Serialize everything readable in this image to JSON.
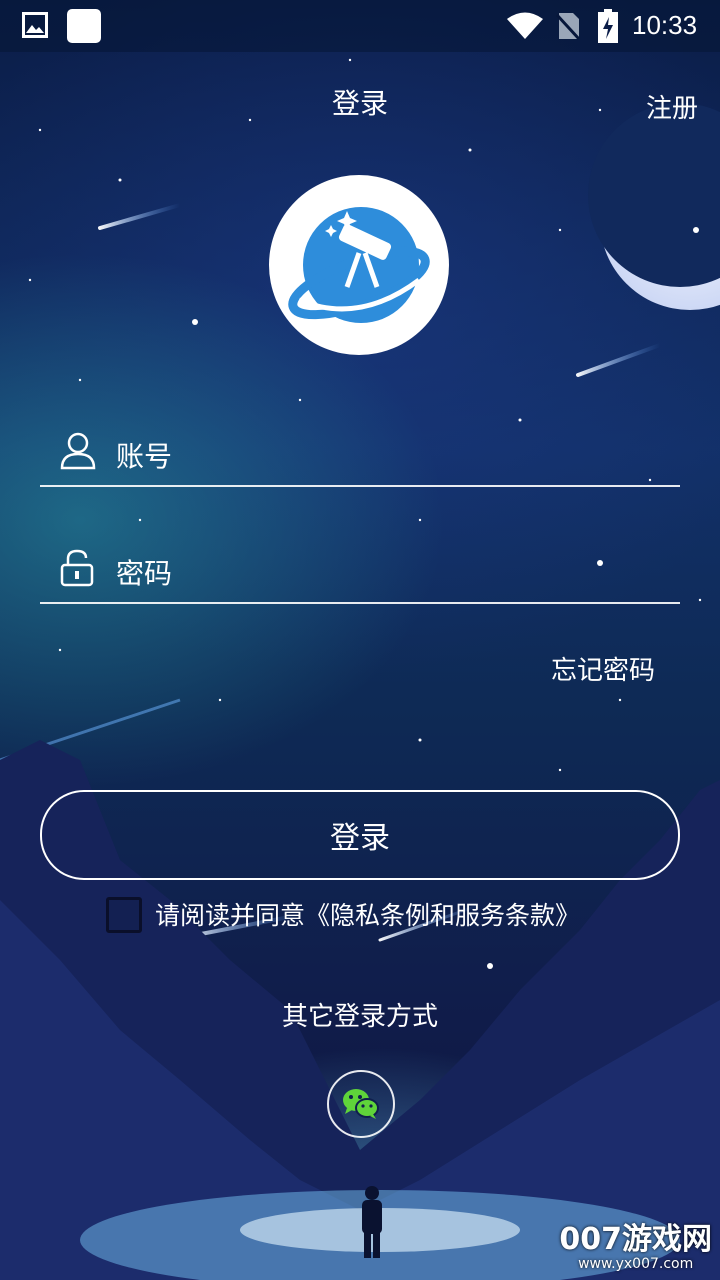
{
  "status_bar": {
    "time": "10:33",
    "icons": [
      "image-icon",
      "app-square-icon",
      "wifi-icon",
      "no-sim-icon",
      "battery-charging-icon"
    ]
  },
  "header": {
    "title": "登录",
    "register_label": "注册"
  },
  "logo": {
    "icon": "telescope-planet-logo"
  },
  "form": {
    "account_placeholder": "账号",
    "password_placeholder": "密码",
    "account_icon": "user-icon",
    "password_icon": "lock-icon",
    "forgot_label": "忘记密码",
    "login_label": "登录",
    "agreement_text": "请阅读并同意《隐私条例和服务条款》",
    "agreement_checked": false
  },
  "other_login": {
    "title": "其它登录方式",
    "providers": [
      "wechat-icon"
    ]
  },
  "watermark": {
    "main": "007游戏网",
    "sub": "www.yx007.com"
  },
  "colors": {
    "logo_blue": "#2e8ddb",
    "wechat_green": "#5fd43a",
    "background_top": "#0b1d48"
  }
}
